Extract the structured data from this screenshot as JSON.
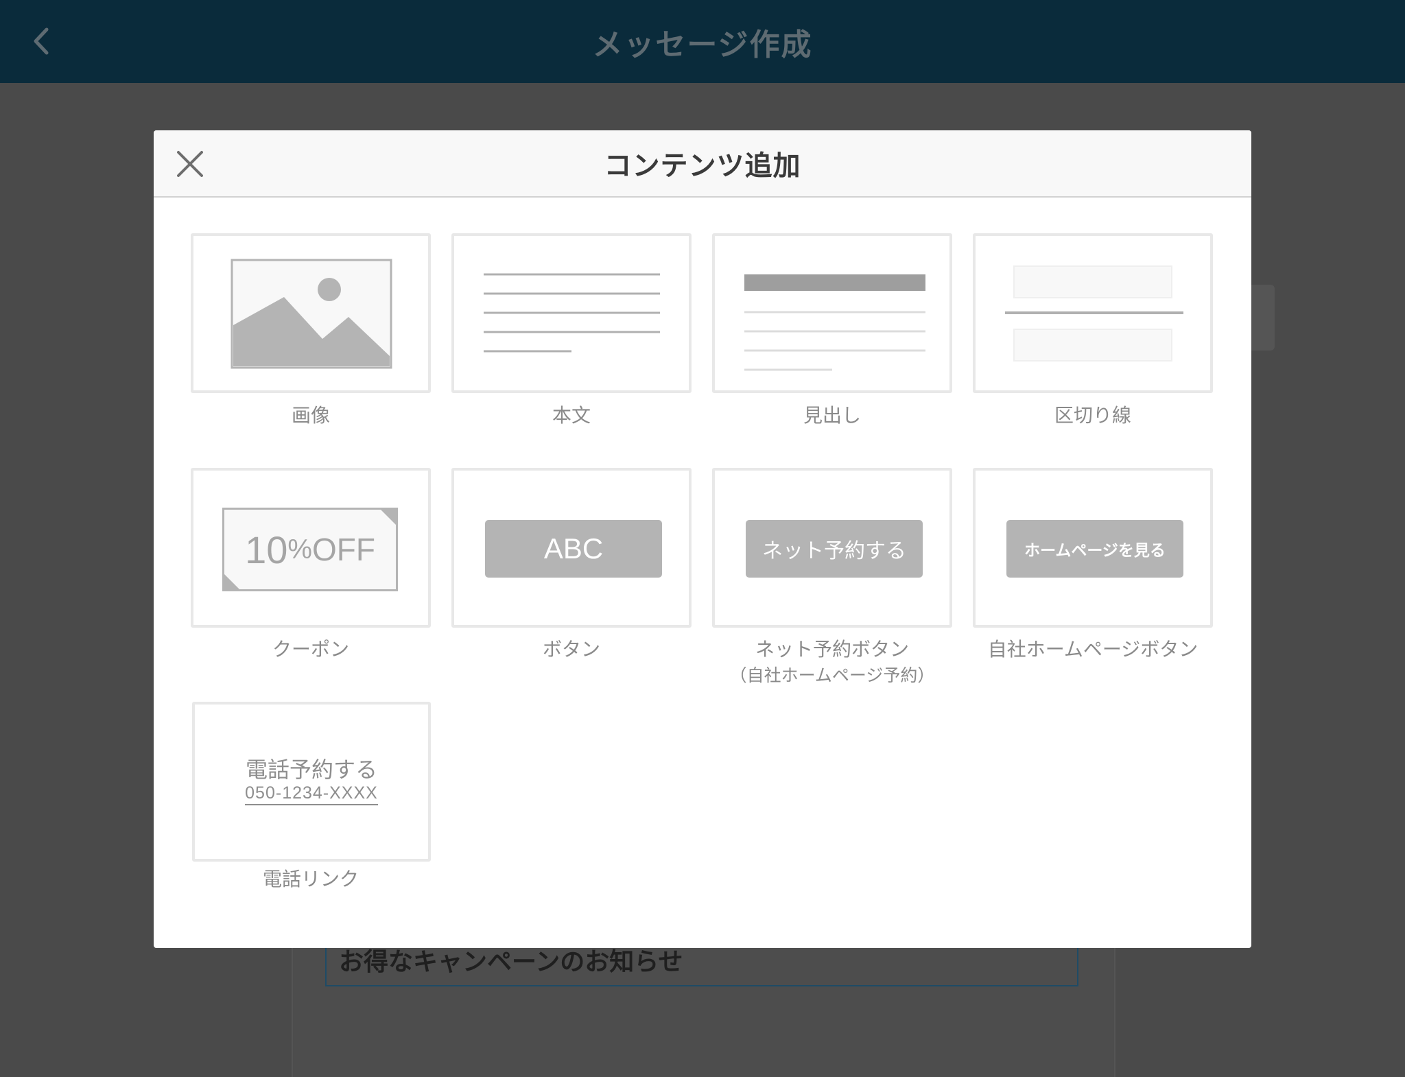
{
  "app_bar": {
    "title": "メッセージ作成",
    "back_icon": "chevron-left-icon"
  },
  "background": {
    "message_title": "お得なキャンペーンのお知らせ"
  },
  "modal": {
    "title": "コンテンツ追加",
    "close_icon": "close-icon",
    "items": [
      {
        "label": "画像",
        "icon": "image-placeholder-icon"
      },
      {
        "label": "本文",
        "icon": "text-lines-icon"
      },
      {
        "label": "見出し",
        "icon": "heading-icon"
      },
      {
        "label": "区切り線",
        "icon": "divider-icon"
      },
      {
        "label": "クーポン",
        "icon": "coupon-icon",
        "preview_number": "10",
        "preview_percent": "%",
        "preview_off": "OFF"
      },
      {
        "label": "ボタン",
        "icon": "button-icon",
        "preview_text": "ABC"
      },
      {
        "label": "ネット予約ボタン",
        "sublabel": "（自社ホームページ予約）",
        "icon": "reservation-button-icon",
        "preview_text": "ネット予約する"
      },
      {
        "label": "自社ホームページボタン",
        "icon": "homepage-button-icon",
        "preview_text": "ホームページを見る"
      },
      {
        "label": "電話リンク",
        "icon": "phone-link-icon",
        "preview_text": "電話予約する",
        "preview_number": "050-1234-XXXX"
      }
    ]
  },
  "colors": {
    "app_bar_bg": "#0a2b3b",
    "overlay_bg": "#4a4a4a",
    "tile_border": "#e8e8e8",
    "preview_grey": "#b4b4b4",
    "label_grey": "#8a8a8a"
  }
}
